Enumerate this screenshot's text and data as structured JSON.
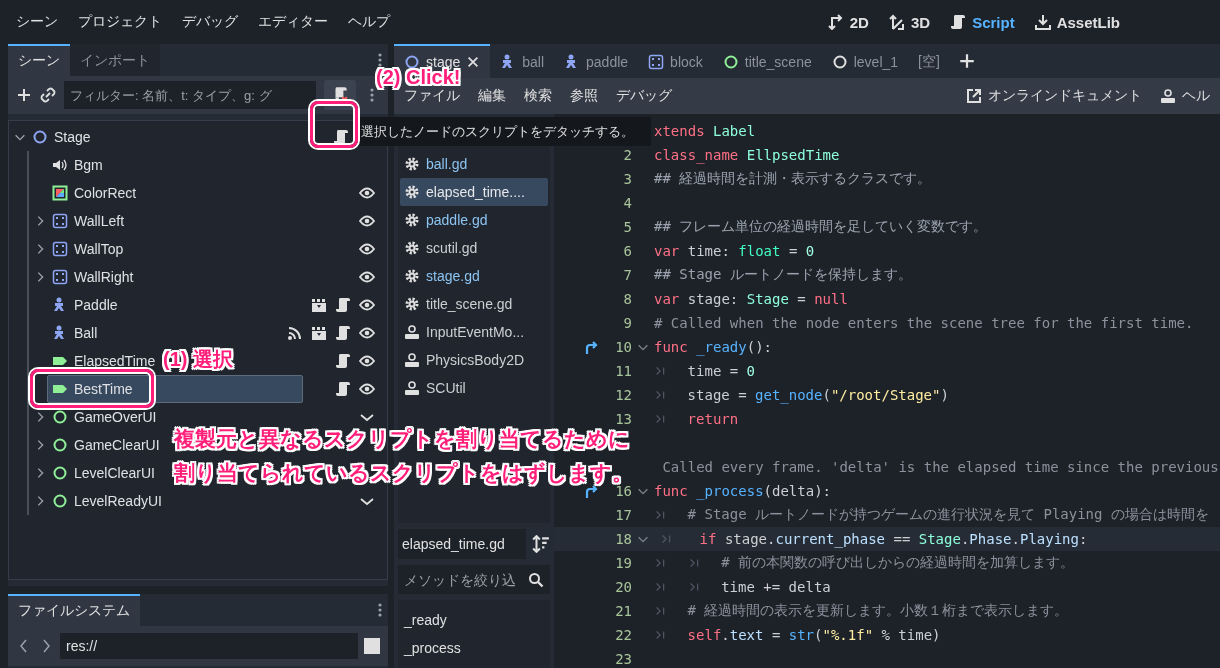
{
  "menu_bar": {
    "items": [
      "シーン",
      "プロジェクト",
      "デバッグ",
      "エディター",
      "ヘルプ"
    ]
  },
  "workspaces": [
    {
      "label": "2D",
      "kind": "planar",
      "selected": false
    },
    {
      "label": "3D",
      "kind": "spatial",
      "selected": false
    },
    {
      "label": "Script",
      "kind": "script",
      "selected": true
    },
    {
      "label": "AssetLib",
      "kind": "download",
      "selected": false
    }
  ],
  "scene_dock": {
    "tabs": [
      {
        "label": "シーン",
        "selected": true
      },
      {
        "label": "インポート",
        "selected": false
      }
    ],
    "filter": {
      "placeholder": "フィルター: 名前、t: タイプ、g: グ"
    },
    "tree": {
      "name": "Stage",
      "kind": "node",
      "expanded": true,
      "selected": false,
      "badges": [
        {
          "kind": "script"
        }
      ],
      "children": [
        {
          "name": "Bgm",
          "kind": "audio",
          "expandable": false,
          "selected": false
        },
        {
          "name": "ColorRect",
          "kind": "colorrect",
          "expandable": false,
          "selected": false,
          "badges": [
            {
              "kind": "eye"
            }
          ]
        },
        {
          "name": "WallLeft",
          "kind": "area",
          "expandable": true,
          "selected": false,
          "badges": [
            {
              "kind": "eye"
            }
          ]
        },
        {
          "name": "WallTop",
          "kind": "area",
          "expandable": true,
          "selected": false,
          "badges": [
            {
              "kind": "eye"
            }
          ]
        },
        {
          "name": "WallRight",
          "kind": "area",
          "expandable": true,
          "selected": false,
          "badges": [
            {
              "kind": "eye"
            }
          ]
        },
        {
          "name": "Paddle",
          "kind": "character",
          "expandable": false,
          "selected": false,
          "badges": [
            {
              "kind": "scene"
            },
            {
              "kind": "script"
            },
            {
              "kind": "eye"
            }
          ]
        },
        {
          "name": "Ball",
          "kind": "character",
          "expandable": false,
          "selected": false,
          "badges": [
            {
              "kind": "signal"
            },
            {
              "kind": "scene"
            },
            {
              "kind": "script"
            },
            {
              "kind": "eye"
            }
          ]
        },
        {
          "name": "ElapsedTime",
          "kind": "label",
          "expandable": false,
          "selected": false,
          "badges": [
            {
              "kind": "script"
            },
            {
              "kind": "eye"
            }
          ]
        },
        {
          "name": "BestTime",
          "kind": "label",
          "expandable": false,
          "selected": true,
          "badges": [
            {
              "kind": "script"
            },
            {
              "kind": "eye"
            }
          ]
        },
        {
          "name": "GameOverUI",
          "kind": "control",
          "expandable": true,
          "selected": false,
          "badges": [
            {
              "kind": "chevron"
            }
          ]
        },
        {
          "name": "GameClearUI",
          "kind": "control",
          "expandable": true,
          "selected": false
        },
        {
          "name": "LevelClearUI",
          "kind": "control",
          "expandable": true,
          "selected": false
        },
        {
          "name": "LevelReadyUI",
          "kind": "control",
          "expandable": true,
          "selected": false,
          "badges": [
            {
              "kind": "chevron"
            }
          ]
        }
      ]
    }
  },
  "tooltip": "選択したノードのスクリプトをデタッチする。",
  "filesystem_dock": {
    "tabs": [
      {
        "label": "ファイルシステム",
        "selected": true
      }
    ],
    "path": "res://"
  },
  "script_tabs": [
    {
      "label": "stage",
      "kind": "node",
      "selected": true
    },
    {
      "label": "ball",
      "kind": "character",
      "selected": false
    },
    {
      "label": "paddle",
      "kind": "character",
      "selected": false
    },
    {
      "label": "block",
      "kind": "area",
      "selected": false
    },
    {
      "label": "title_scene",
      "kind": "control",
      "selected": false
    },
    {
      "label": "level_1",
      "kind": "ring",
      "selected": false
    },
    {
      "label": "[空]",
      "selected": false
    }
  ],
  "script_menu": {
    "items": [
      "ファイル",
      "編集",
      "検索",
      "参照",
      "デバッグ"
    ],
    "online_docs": "オンラインドキュメント",
    "help": "ヘル"
  },
  "script_list": {
    "items": [
      {
        "name": "ball.gd",
        "kind": "gear",
        "color": "#8cc4f2",
        "selected": false
      },
      {
        "name": "elapsed_time....",
        "kind": "gear",
        "color": "#e6e8eb",
        "selected": true
      },
      {
        "name": "paddle.gd",
        "kind": "gear",
        "color": "#8cc4f2",
        "selected": false
      },
      {
        "name": "scutil.gd",
        "kind": "gear",
        "color": "#cdcfd2",
        "selected": false
      },
      {
        "name": "stage.gd",
        "kind": "gear",
        "color": "#8cc4f2",
        "selected": false
      },
      {
        "name": "title_scene.gd",
        "kind": "gear",
        "color": "#cdcfd2",
        "selected": false
      },
      {
        "name": "InputEventMo...",
        "kind": "doc",
        "color": "#cdcfd2",
        "selected": false
      },
      {
        "name": "PhysicsBody2D",
        "kind": "doc",
        "color": "#cdcfd2",
        "selected": false
      },
      {
        "name": "SCUtil",
        "kind": "doc",
        "color": "#cdcfd2",
        "selected": false
      }
    ],
    "current_file": "elapsed_time.gd",
    "method_filter": {
      "placeholder": "メソッドを絞り込"
    },
    "methods": [
      "_ready",
      "_process"
    ]
  },
  "code": {
    "lines": [
      {
        "current": false,
        "tokens": [
          {
            "kind": "kw",
            "text": "xtends"
          },
          {
            "kind": "cls",
            "text": " Label"
          }
        ]
      },
      {
        "num": "2",
        "current": false,
        "tokens": [
          {
            "kind": "kw",
            "text": "class_name"
          },
          {
            "kind": "cls",
            "text": " EllpsedTime"
          }
        ]
      },
      {
        "num": "3",
        "current": false,
        "tokens": [
          {
            "kind": "doc",
            "text": "## 経過時間を計測・表示するクラスです。"
          }
        ]
      },
      {
        "num": "4",
        "current": false
      },
      {
        "num": "5",
        "current": false,
        "tokens": [
          {
            "kind": "doc",
            "text": "## フレーム単位の経過時間を足していく変数です。"
          }
        ]
      },
      {
        "num": "6",
        "current": false,
        "tokens": [
          {
            "kind": "kw",
            "text": "var"
          },
          {
            "kind": "p",
            "text": " time: "
          },
          {
            "kind": "type",
            "text": "float"
          },
          {
            "kind": "p",
            "text": " = "
          },
          {
            "kind": "num",
            "text": "0"
          }
        ]
      },
      {
        "num": "7",
        "current": false,
        "tokens": [
          {
            "kind": "doc",
            "text": "## Stage ルートノードを保持します。"
          }
        ]
      },
      {
        "num": "8",
        "current": false,
        "tokens": [
          {
            "kind": "kw",
            "text": "var"
          },
          {
            "kind": "p",
            "text": " stage: "
          },
          {
            "kind": "cls",
            "text": "Stage"
          },
          {
            "kind": "p",
            "text": " = "
          },
          {
            "kind": "kw",
            "text": "null"
          }
        ]
      },
      {
        "num": "9",
        "current": false,
        "tokens": [
          {
            "kind": "com",
            "text": "# Called when the node enters the scene tree for the first time."
          }
        ]
      },
      {
        "num": "10",
        "current": false,
        "override": true,
        "foldable": true,
        "tokens": [
          {
            "kind": "kw",
            "text": "func"
          },
          {
            "kind": "fn",
            "text": " _ready"
          },
          {
            "kind": "p",
            "text": "():"
          }
        ]
      },
      {
        "num": "11",
        "current": false,
        "indent": [
          {
            "kind": "tab"
          }
        ],
        "tokens": [
          {
            "kind": "p",
            "text": "time = "
          },
          {
            "kind": "num",
            "text": "0"
          }
        ]
      },
      {
        "num": "12",
        "current": false,
        "indent": [
          {
            "kind": "tab"
          }
        ],
        "tokens": [
          {
            "kind": "p",
            "text": "stage = "
          },
          {
            "kind": "fn",
            "text": "get_node"
          },
          {
            "kind": "p",
            "text": "("
          },
          {
            "kind": "str",
            "text": "\"/root/Stage\""
          },
          {
            "kind": "p",
            "text": ")"
          }
        ]
      },
      {
        "num": "13",
        "current": false,
        "indent": [
          {
            "kind": "tab"
          }
        ],
        "tokens": [
          {
            "kind": "kw",
            "text": "return"
          }
        ]
      },
      {
        "current": false
      },
      {
        "current": false,
        "tokens": [
          {
            "kind": "com",
            "text": " Called every frame. 'delta' is the elapsed time since the previous"
          }
        ]
      },
      {
        "num": "16",
        "current": false,
        "override": true,
        "foldable": true,
        "tokens": [
          {
            "kind": "kw",
            "text": "func"
          },
          {
            "kind": "fn",
            "text": " _process"
          },
          {
            "kind": "p",
            "text": "(delta):"
          }
        ]
      },
      {
        "num": "17",
        "current": false,
        "indent": [
          {
            "kind": "tab"
          }
        ],
        "tokens": [
          {
            "kind": "com",
            "text": "# Stage ルートノードが持つゲームの進行状況を見て Playing の場合は時間を"
          }
        ]
      },
      {
        "num": "18",
        "current": true,
        "foldable": true,
        "indent": [
          {
            "kind": "tab"
          }
        ],
        "tokens": [
          {
            "kind": "kw",
            "text": "if"
          },
          {
            "kind": "p",
            "text": " stage."
          },
          {
            "kind": "mem",
            "text": "current_phase"
          },
          {
            "kind": "p",
            "text": " == "
          },
          {
            "kind": "cls",
            "text": "Stage"
          },
          {
            "kind": "p",
            "text": "."
          },
          {
            "kind": "mem",
            "text": "Phase"
          },
          {
            "kind": "p",
            "text": "."
          },
          {
            "kind": "mem",
            "text": "Playing"
          },
          {
            "kind": "p",
            "text": ":"
          }
        ]
      },
      {
        "num": "19",
        "current": false,
        "indent": [
          {
            "kind": "tab"
          },
          {
            "kind": "tab"
          }
        ],
        "tokens": [
          {
            "kind": "com",
            "text": "# 前の本関数の呼び出しからの経過時間を加算します。"
          }
        ]
      },
      {
        "num": "20",
        "current": false,
        "indent": [
          {
            "kind": "tab"
          },
          {
            "kind": "tab"
          }
        ],
        "tokens": [
          {
            "kind": "p",
            "text": "time += delta"
          }
        ]
      },
      {
        "num": "21",
        "current": false,
        "indent": [
          {
            "kind": "tab"
          }
        ],
        "tokens": [
          {
            "kind": "com",
            "text": "# 経過時間の表示を更新します。小数１桁まで表示します。"
          }
        ]
      },
      {
        "num": "22",
        "current": false,
        "indent": [
          {
            "kind": "tab"
          }
        ],
        "tokens": [
          {
            "kind": "kw",
            "text": "self"
          },
          {
            "kind": "p",
            "text": "."
          },
          {
            "kind": "mem",
            "text": "text"
          },
          {
            "kind": "p",
            "text": " = "
          },
          {
            "kind": "fn",
            "text": "str"
          },
          {
            "kind": "p",
            "text": "("
          },
          {
            "kind": "str",
            "text": "\"%.1f\""
          },
          {
            "kind": "p",
            "text": " % time)"
          }
        ]
      },
      {
        "num": "23",
        "current": false
      }
    ]
  },
  "annotations": {
    "step_1": "(1) 選択",
    "step_2": "(2) Click!",
    "note": [
      "複製元と異なるスクリプトを割り当てるために",
      "割り当てられているスクリプトをはずします。"
    ]
  }
}
